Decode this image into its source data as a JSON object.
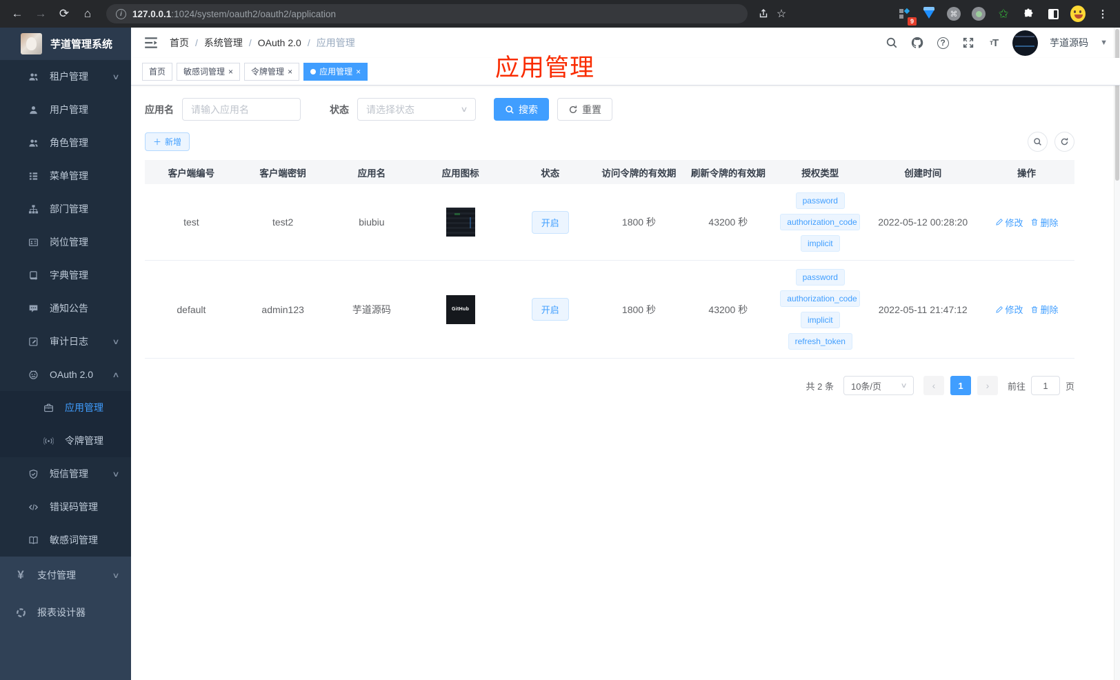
{
  "browser": {
    "url_host": "127.0.0.1",
    "url_rest": ":1024/system/oauth2/oauth2/application",
    "extension_badge": "9",
    "icons": [
      "back-icon",
      "forward-icon",
      "reload-icon",
      "home-icon",
      "info-icon",
      "share-icon",
      "star-icon",
      "extension-grid-icon",
      "gem-extension-icon",
      "command-extension-icon",
      "record-extension-icon",
      "green-star-extension-icon",
      "puzzle-icon",
      "split-window-icon",
      "profile-emoji-icon",
      "menu-dots-icon"
    ]
  },
  "sidebar": {
    "logo_title": "芋道管理系统",
    "items": [
      {
        "label": "租户管理",
        "icon": "users-icon",
        "chevron": "down",
        "level": "lvl1"
      },
      {
        "label": "用户管理",
        "icon": "user-icon",
        "level": "lvl1"
      },
      {
        "label": "角色管理",
        "icon": "users-icon",
        "level": "lvl1"
      },
      {
        "label": "菜单管理",
        "icon": "menu-tree-icon",
        "level": "lvl1"
      },
      {
        "label": "部门管理",
        "icon": "sitemap-icon",
        "level": "lvl1"
      },
      {
        "label": "岗位管理",
        "icon": "idcard-icon",
        "level": "lvl1"
      },
      {
        "label": "字典管理",
        "icon": "dictionary-icon",
        "level": "lvl1"
      },
      {
        "label": "通知公告",
        "icon": "announcement-icon",
        "level": "lvl1"
      },
      {
        "label": "审计日志",
        "icon": "audit-log-icon",
        "chevron": "down",
        "level": "lvl1"
      },
      {
        "label": "OAuth 2.0",
        "icon": "oauth-robot-icon",
        "chevron": "up",
        "level": "lvl1"
      },
      {
        "label": "应用管理",
        "icon": "briefcase-icon",
        "level": "lvl2",
        "active": true
      },
      {
        "label": "令牌管理",
        "icon": "token-signal-icon",
        "level": "lvl2"
      },
      {
        "label": "短信管理",
        "icon": "shield-check-icon",
        "chevron": "down",
        "level": "lvl1"
      },
      {
        "label": "错误码管理",
        "icon": "code-icon",
        "level": "lvl1"
      },
      {
        "label": "敏感词管理",
        "icon": "open-book-icon",
        "level": "lvl1"
      },
      {
        "label": "支付管理",
        "icon": "yen-icon",
        "chevron": "down",
        "level": "root"
      },
      {
        "label": "报表设计器",
        "icon": "report-icon",
        "level": "root"
      }
    ]
  },
  "header": {
    "breadcrumb": [
      "首页",
      "系统管理",
      "OAuth 2.0",
      "应用管理"
    ],
    "icons": [
      "search-icon",
      "github-icon",
      "question-icon",
      "fullscreen-icon",
      "font-size-icon"
    ],
    "user_name": "芋道源码"
  },
  "overlay_title": "应用管理",
  "tabs": [
    {
      "label": "首页",
      "closable": false,
      "active": false
    },
    {
      "label": "敏感词管理",
      "closable": true,
      "active": false
    },
    {
      "label": "令牌管理",
      "closable": true,
      "active": false
    },
    {
      "label": "应用管理",
      "closable": true,
      "active": true
    }
  ],
  "filter": {
    "app_name_label": "应用名",
    "app_name_placeholder": "请输入应用名",
    "status_label": "状态",
    "status_placeholder": "请选择状态",
    "search_label": "搜索",
    "reset_label": "重置",
    "add_label": "新增"
  },
  "table": {
    "columns": [
      "客户端编号",
      "客户端密钥",
      "应用名",
      "应用图标",
      "状态",
      "访问令牌的有效期",
      "刷新令牌的有效期",
      "授权类型",
      "创建时间",
      "操作"
    ],
    "rows": [
      {
        "client_id": "test",
        "secret": "test2",
        "name": "biubiu",
        "icon_type": "screenshot",
        "status": "开启",
        "access_validity": "1800 秒",
        "refresh_validity": "43200 秒",
        "grant_types": [
          "password",
          "authorization_code",
          "implicit"
        ],
        "create_time": "2022-05-12 00:28:20"
      },
      {
        "client_id": "default",
        "secret": "admin123",
        "name": "芋道源码",
        "icon_type": "github",
        "icon_text": "GitHub",
        "status": "开启",
        "access_validity": "1800 秒",
        "refresh_validity": "43200 秒",
        "grant_types": [
          "password",
          "authorization_code",
          "implicit",
          "refresh_token"
        ],
        "create_time": "2022-05-11 21:47:12"
      }
    ],
    "edit_label": "修改",
    "delete_label": "删除"
  },
  "pagination": {
    "total_text": "共 2 条",
    "page_size": "10条/页",
    "current_page": "1",
    "goto_label": "前往",
    "goto_value": "1",
    "page_label": "页"
  },
  "colors": {
    "accent": "#409eff",
    "tag_bg": "#ecf5ff",
    "tag_border": "#d9ecff",
    "overlay_title_red": "#f92c00",
    "sidebar_bg": "#304156",
    "sidebar_submenu_bg": "#1f2d3d",
    "chrome_bg": "#26282b"
  }
}
